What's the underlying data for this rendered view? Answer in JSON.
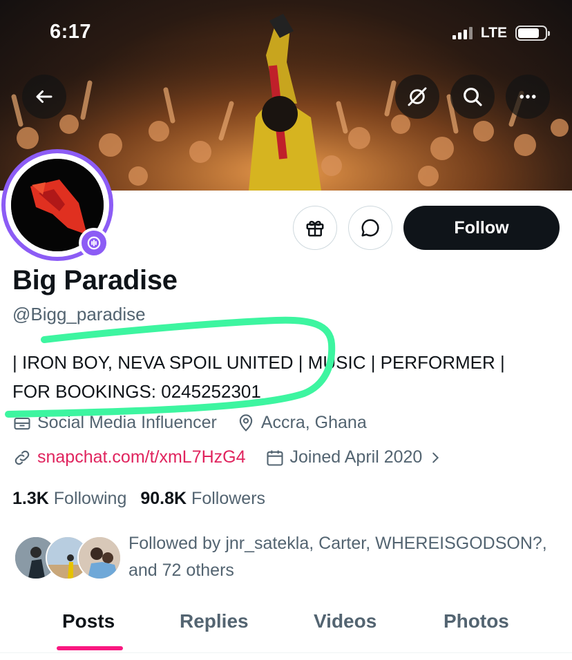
{
  "status_bar": {
    "time": "6:17",
    "network": "LTE",
    "battery_level": 0.8
  },
  "header": {
    "back_icon": "arrow-left-icon",
    "actions": [
      "broadcast-icon",
      "search-icon",
      "more-icon"
    ]
  },
  "profile": {
    "name": "Big Paradise",
    "handle": "@Bigg_paradise",
    "bio_line1": "| IRON BOY, NEVA SPOIL UNITED | MUSIC | PERFORMER |",
    "bio_line2": "FOR BOOKINGS: 0245252301",
    "category": "Social Media Influencer",
    "location": "Accra, Ghana",
    "link": "snapchat.com/t/xmL7HzG4",
    "joined": "Joined April 2020",
    "following_count": "1.3K",
    "following_label": "Following",
    "followers_count": "90.8K",
    "followers_label": "Followers",
    "followed_by": "Followed by jnr_satekla, Carter, WHEREISGODSON?, and 72 others"
  },
  "actions": {
    "follow_label": "Follow",
    "gift_icon": "gift-icon",
    "message_icon": "message-icon"
  },
  "tabs": [
    {
      "label": "Posts",
      "active": true
    },
    {
      "label": "Replies",
      "active": false
    },
    {
      "label": "Videos",
      "active": false
    },
    {
      "label": "Photos",
      "active": false
    }
  ],
  "colors": {
    "accent": "#f91880",
    "link": "#e0245e",
    "avatar_ring": "#8c5cf5",
    "highlight": "#3df5a0",
    "follow_button": "#0f1419"
  }
}
